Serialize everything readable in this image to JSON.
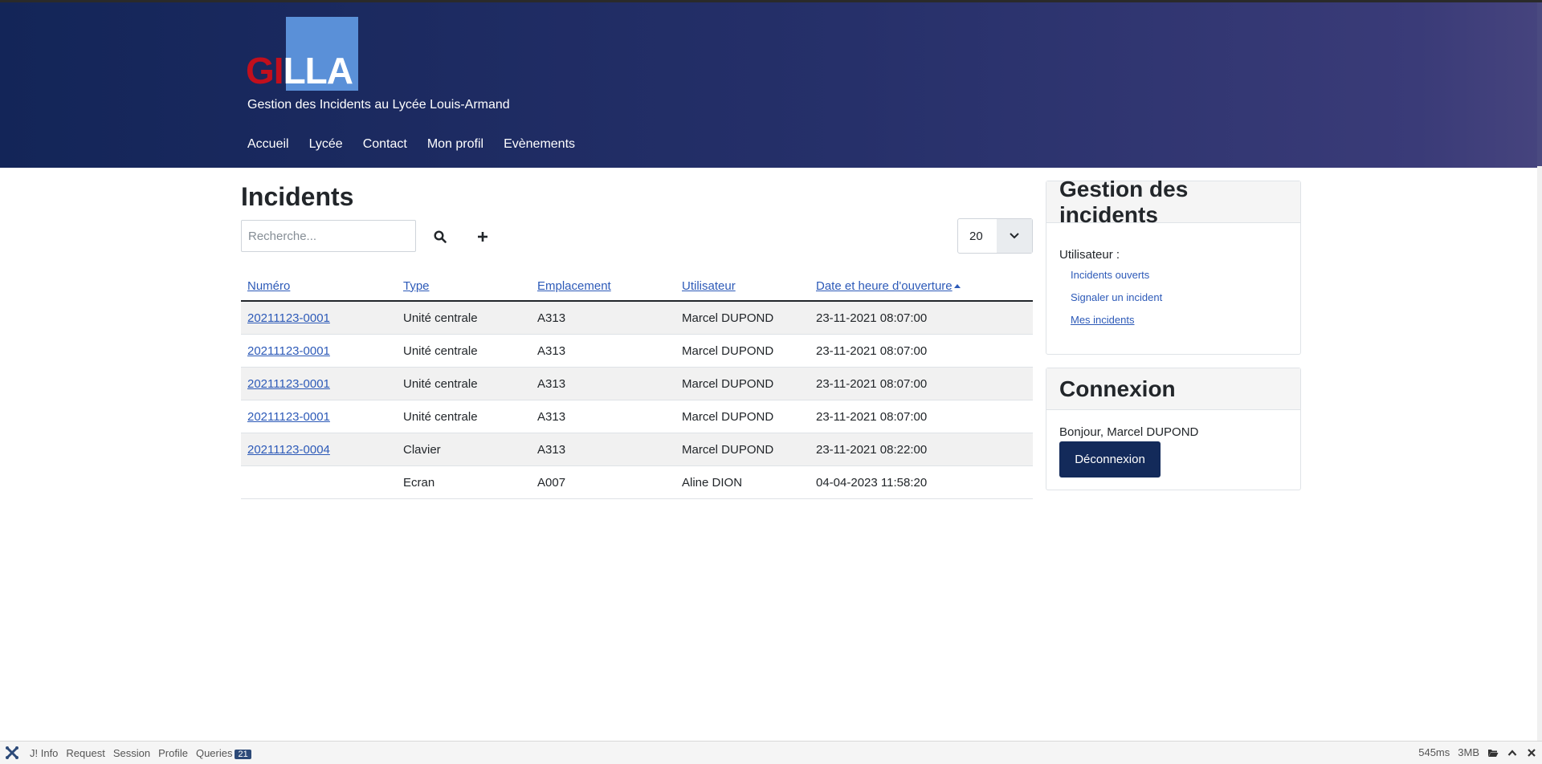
{
  "header": {
    "logo": {
      "part1": "GI",
      "part2": "LLA"
    },
    "tagline": "Gestion des Incidents au Lycée Louis-Armand",
    "nav": [
      "Accueil",
      "Lycée",
      "Contact",
      "Mon profil",
      "Evènements"
    ]
  },
  "main": {
    "title": "Incidents",
    "search": {
      "placeholder": "Recherche...",
      "value": ""
    },
    "limit": "20",
    "columns": [
      "Numéro",
      "Type",
      "Emplacement",
      "Utilisateur",
      "Date et heure d'ouverture"
    ],
    "rows": [
      {
        "numero": "20211123-0001",
        "type": "Unité centrale",
        "emplacement": "A313",
        "utilisateur": "Marcel DUPOND",
        "date": "23-11-2021 08:07:00"
      },
      {
        "numero": "20211123-0001",
        "type": "Unité centrale",
        "emplacement": "A313",
        "utilisateur": "Marcel DUPOND",
        "date": "23-11-2021 08:07:00"
      },
      {
        "numero": "20211123-0001",
        "type": "Unité centrale",
        "emplacement": "A313",
        "utilisateur": "Marcel DUPOND",
        "date": "23-11-2021 08:07:00"
      },
      {
        "numero": "20211123-0001",
        "type": "Unité centrale",
        "emplacement": "A313",
        "utilisateur": "Marcel DUPOND",
        "date": "23-11-2021 08:07:00"
      },
      {
        "numero": "20211123-0004",
        "type": "Clavier",
        "emplacement": "A313",
        "utilisateur": "Marcel DUPOND",
        "date": "23-11-2021 08:22:00"
      },
      {
        "numero": "",
        "type": "Ecran",
        "emplacement": "A007",
        "utilisateur": "Aline DION",
        "date": "04-04-2023 11:58:20"
      }
    ]
  },
  "sidebar": {
    "incidents_card": {
      "title": "Gestion des incidents",
      "user_label": "Utilisateur :",
      "links": [
        "Incidents ouverts",
        "Signaler un incident",
        "Mes incidents"
      ]
    },
    "login_card": {
      "title": "Connexion",
      "greeting": "Bonjour, Marcel DUPOND",
      "logout_label": "Déconnexion"
    }
  },
  "debugbar": {
    "items": [
      "J! Info",
      "Request",
      "Session",
      "Profile",
      "Queries"
    ],
    "queries_count": "21",
    "time": "545ms",
    "memory": "3MB"
  },
  "colors": {
    "header_start": "#132558",
    "header_end": "#46447e",
    "logo_red": "#c10f1d",
    "logo_blue": "#5a90d8",
    "link": "#2d5ab8",
    "button": "#132a5a"
  }
}
